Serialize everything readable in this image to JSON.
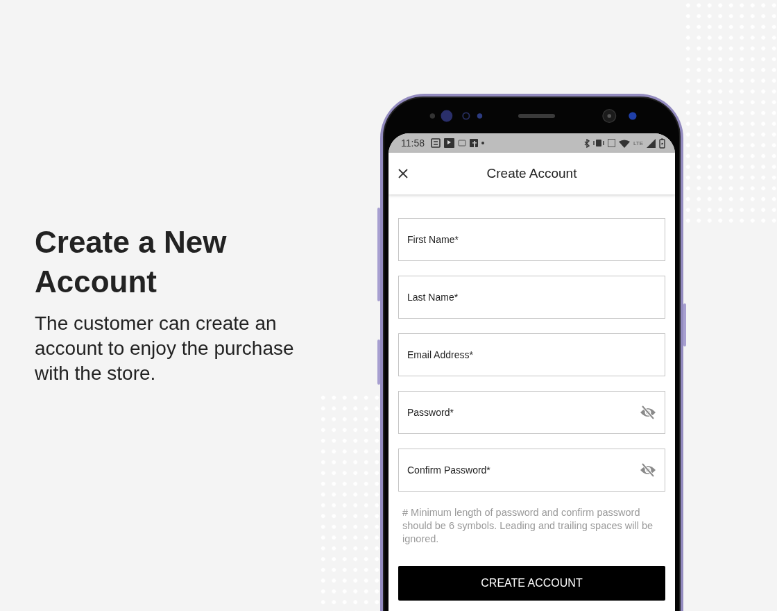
{
  "promo": {
    "heading": "Create a New Account",
    "description": "The customer can create an account to enjoy the purchase with the store."
  },
  "status_bar": {
    "time": "11:58",
    "network": "LTE"
  },
  "app_bar": {
    "title": "Create Account"
  },
  "fields": [
    {
      "placeholder": "First Name*",
      "kind": "text"
    },
    {
      "placeholder": "Last Name*",
      "kind": "text"
    },
    {
      "placeholder": "Email Address*",
      "kind": "text"
    },
    {
      "placeholder": "Password*",
      "kind": "password"
    },
    {
      "placeholder": "Confirm Password*",
      "kind": "password"
    }
  ],
  "hint": "# Minimum length of password and confirm password should be 6 symbols. Leading and trailing spaces will be ignored.",
  "button": "CREATE ACCOUNT"
}
